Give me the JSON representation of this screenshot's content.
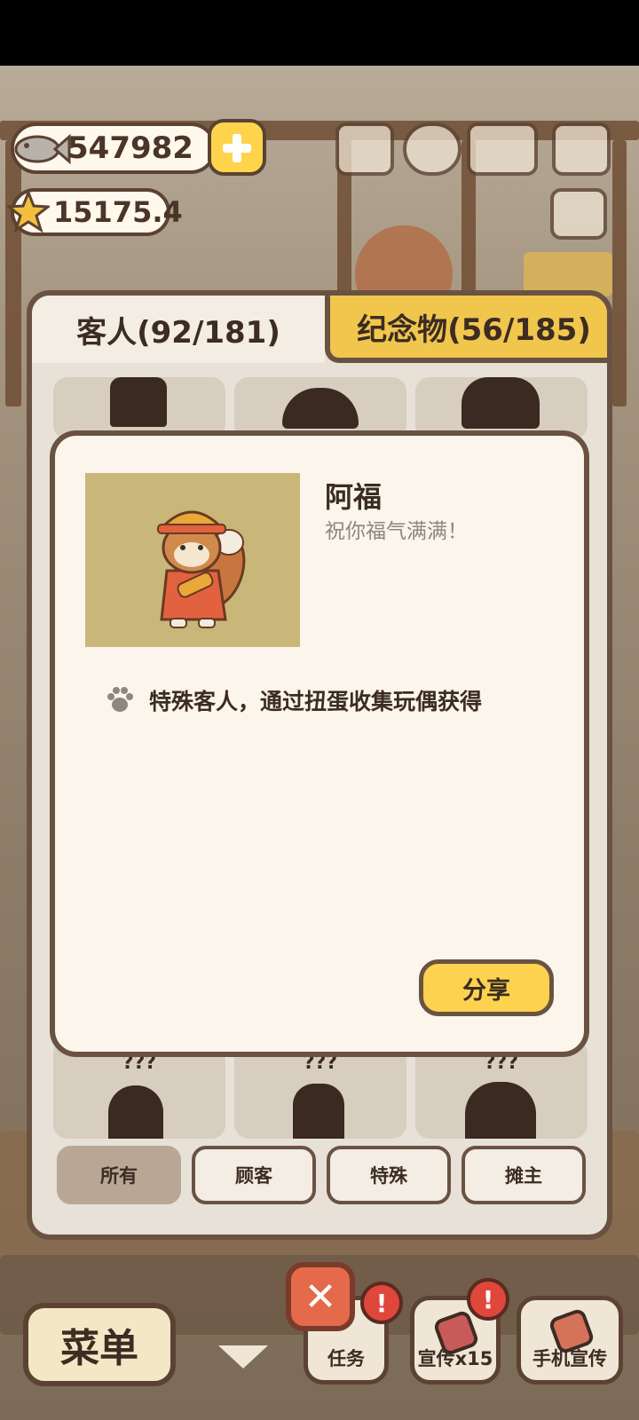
{
  "currency": {
    "fish": "547982",
    "stars": "15175.4"
  },
  "tabs": [
    {
      "label": "客人(92/181)",
      "active": true
    },
    {
      "label": "纪念物(56/185)",
      "active": false
    }
  ],
  "detail": {
    "name": "阿福",
    "quote": "祝你福气满满！",
    "description": "特殊客人，通过扭蛋收集玩偶获得",
    "share_label": "分享"
  },
  "locked_slots": {
    "label": "???"
  },
  "filters": [
    {
      "label": "所有",
      "active": true
    },
    {
      "label": "顾客",
      "active": false
    },
    {
      "label": "特殊",
      "active": false
    },
    {
      "label": "摊主",
      "active": false
    }
  ],
  "hud": {
    "menu_label": "菜单",
    "close_label": "✕",
    "tasks_label": "任务",
    "promo_label": "宣传x15",
    "phone_promo_label": "手机宣传",
    "alert_label": "!"
  },
  "colors": {
    "accent_yellow": "#fdd24e",
    "panel_border": "#6a5242",
    "portrait_bg": "#c9b679"
  }
}
